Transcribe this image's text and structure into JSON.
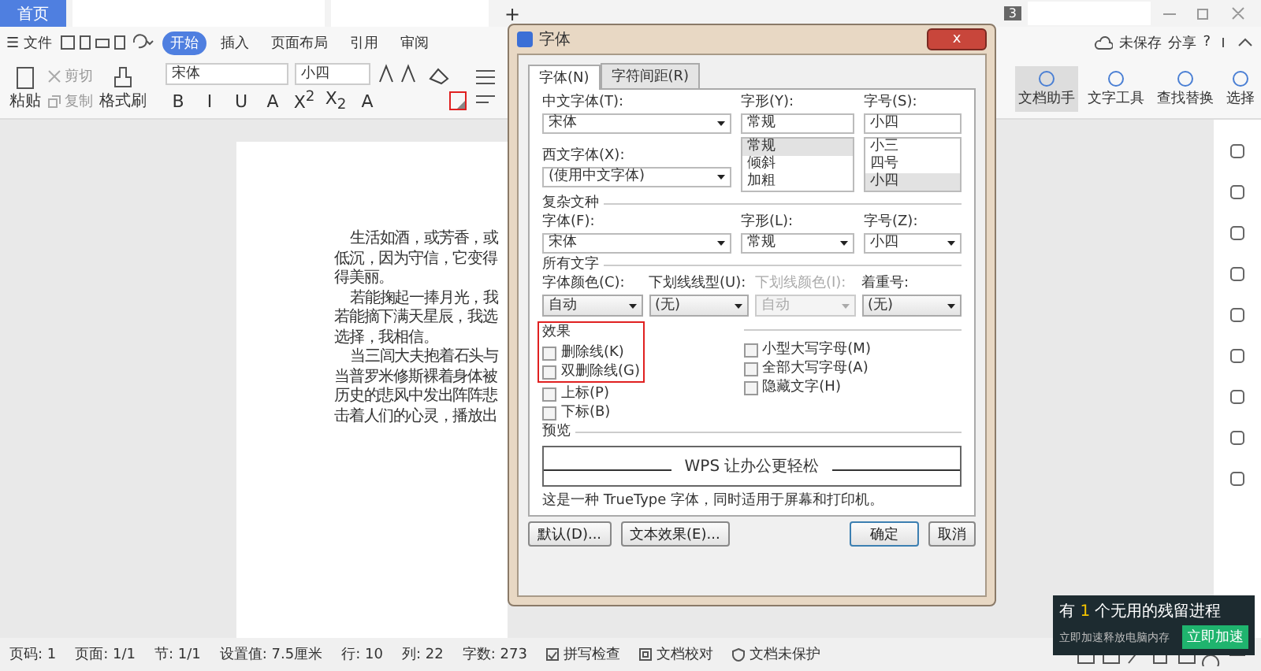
{
  "top_bar": {
    "home_tab": "首页",
    "new_tab": "+",
    "badge": "3"
  },
  "menu": {
    "file": "文件",
    "menu_icon": "☰",
    "tabs": [
      {
        "label": "开始",
        "selected": true
      },
      {
        "label": "插入",
        "selected": false
      },
      {
        "label": "页面布局",
        "selected": false
      },
      {
        "label": "引用",
        "selected": false
      },
      {
        "label": "审阅",
        "selected": false
      }
    ],
    "unsaved": "未保存",
    "share": "分享",
    "help": "?"
  },
  "ribbon": {
    "paste": "粘贴",
    "cut": "剪切",
    "copy": "复制",
    "format_painter": "格式刷",
    "font": "宋体",
    "size": "小四",
    "glyphs": [
      "B",
      "I",
      "U",
      "A",
      "X$^{2}$",
      "X$_{2}$",
      "A"
    ],
    "launcher_marked": true,
    "tools": [
      {
        "label": "文档助手",
        "selected": true
      },
      {
        "label": "文字工具",
        "selected": false
      },
      {
        "label": "查找替换",
        "selected": false
      },
      {
        "label": "选择",
        "selected": false
      }
    ]
  },
  "document": {
    "paragraphs": [
      [
        "生活如酒，或芳香，或",
        "低沉，因为守信，它变得",
        "得美丽。"
      ],
      [
        "若能掬起一捧月光，我",
        "若能摘下满天星辰，我选",
        "选择，我相信。"
      ],
      [
        "当三闾大夫抱着石头与",
        "当普罗米修斯裸着身体被",
        "历史的悲风中发出阵阵悲",
        "击着人们的心灵，播放出"
      ]
    ]
  },
  "dialog": {
    "title": "字体",
    "close": "x",
    "tabs": [
      {
        "label": "字体(N)",
        "selected": true
      },
      {
        "label": "字符间距(R)",
        "selected": false
      }
    ],
    "chinese_font": {
      "label": "中文字体(T):",
      "value": "宋体"
    },
    "style": {
      "label": "字形(Y):",
      "value": "常规",
      "options": [
        {
          "label": "常规",
          "selected": true
        },
        {
          "label": "倾斜",
          "selected": false
        },
        {
          "label": "加粗",
          "selected": false
        }
      ]
    },
    "size": {
      "label": "字号(S):",
      "value": "小四",
      "options": [
        {
          "label": "小三",
          "selected": false
        },
        {
          "label": "四号",
          "selected": false
        },
        {
          "label": "小四",
          "selected": true
        }
      ]
    },
    "western_font": {
      "label": "西文字体(X):",
      "value": "(使用中文字体)"
    },
    "complex": {
      "title": "复杂文种",
      "fields": [
        {
          "label": "字体(F):",
          "value": "宋体"
        },
        {
          "label": "字形(L):",
          "value": "常规"
        },
        {
          "label": "字号(Z):",
          "value": "小四"
        }
      ]
    },
    "all_text": {
      "title": "所有文字",
      "fields": [
        {
          "label": "字体颜色(C):",
          "value": "自动",
          "disabled": false
        },
        {
          "label": "下划线线型(U):",
          "value": "(无)",
          "disabled": false
        },
        {
          "label": "下划线颜色(I):",
          "value": "自动",
          "disabled": true
        },
        {
          "label": "着重号:",
          "value": "(无)",
          "disabled": false
        }
      ]
    },
    "effects": {
      "title": "效果",
      "marked": true,
      "left": [
        {
          "label": "删除线(K)",
          "checked": false
        },
        {
          "label": "双删除线(G)",
          "checked": false
        },
        {
          "label": "上标(P)",
          "checked": false
        },
        {
          "label": "下标(B)",
          "checked": false
        }
      ],
      "right": [
        {
          "label": "小型大写字母(M)",
          "checked": false
        },
        {
          "label": "全部大写字母(A)",
          "checked": false
        },
        {
          "label": "隐藏文字(H)",
          "checked": false
        }
      ]
    },
    "preview": {
      "title": "预览",
      "sample": "WPS 让办公更轻松",
      "note": "这是一种 TrueType 字体，同时适用于屏幕和打印机。"
    },
    "buttons": [
      {
        "label": "默认(D)...",
        "kind": "plain"
      },
      {
        "label": "文本效果(E)...",
        "kind": "plain"
      },
      {
        "label": "确定",
        "kind": "primary"
      },
      {
        "label": "取消",
        "kind": "plain"
      }
    ]
  },
  "status_bar": {
    "items": [
      "页码: 1",
      "页面: 1/1",
      "节: 1/1",
      "设置值: 7.5厘米",
      "行: 10",
      "列: 22",
      "字数: 273"
    ],
    "spell": "拼写检查",
    "proof": "文档校对",
    "protect": "文档未保护"
  },
  "notification": {
    "before": "有 ",
    "count": "1",
    "after": " 个无用的残留进程",
    "subtitle": "立即加速释放电脑内存",
    "button": "立即加速"
  }
}
